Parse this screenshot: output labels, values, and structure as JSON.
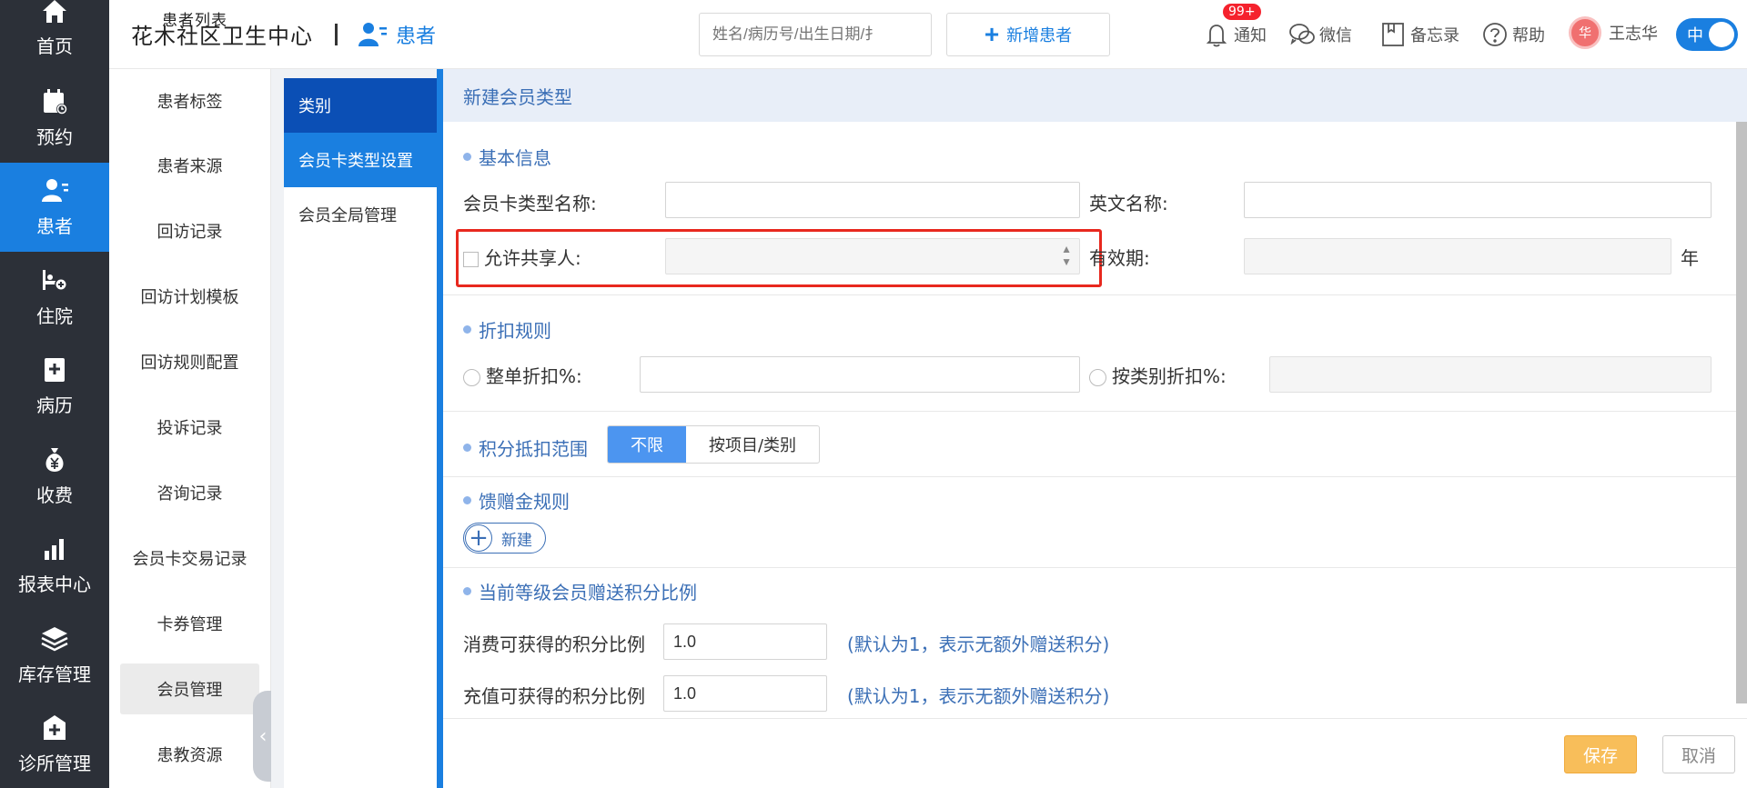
{
  "nav": {
    "items": [
      {
        "label": "首页",
        "icon": "home-icon"
      },
      {
        "label": "预约",
        "icon": "calendar-icon"
      },
      {
        "label": "患者",
        "icon": "patient-icon",
        "active": true
      },
      {
        "label": "住院",
        "icon": "bed-icon"
      },
      {
        "label": "病历",
        "icon": "medical-record-icon"
      },
      {
        "label": "收费",
        "icon": "money-bag-icon"
      },
      {
        "label": "报表中心",
        "icon": "bar-chart-icon"
      },
      {
        "label": "库存管理",
        "icon": "layers-icon"
      },
      {
        "label": "诊所管理",
        "icon": "clinic-icon"
      }
    ]
  },
  "header": {
    "clinic_name": "花木社区卫生中心",
    "ghost_text": "患者列表",
    "module": "患者",
    "search_placeholder": "姓名/病历号/出生日期/扌",
    "add_patient": "新增患者",
    "notify": "通知",
    "notify_badge": "99+",
    "wechat": "微信",
    "memo": "备忘录",
    "help": "帮助",
    "user": "王志华",
    "avatar_char": "华",
    "toggle": "中"
  },
  "subnav": {
    "items": [
      "患者标签",
      "患者来源",
      "回访记录",
      "回访计划模板",
      "回访规则配置",
      "投诉记录",
      "咨询记录",
      "会员卡交易记录",
      "卡券管理",
      "会员管理",
      "患教资源"
    ],
    "active_index": 9
  },
  "category": {
    "header": "类别",
    "items": [
      "会员卡类型设置",
      "会员全局管理"
    ]
  },
  "form": {
    "title": "新建会员类型",
    "basic": {
      "section": "基本信息",
      "name_label": "会员卡类型名称:",
      "name_value": "",
      "en_label": "英文名称:",
      "en_value": "",
      "share_label": "允许共享人:",
      "share_value": "",
      "validity_label": "有效期:",
      "validity_value": "",
      "validity_unit": "年"
    },
    "discount": {
      "section": "折扣规则",
      "whole_label": "整单折扣%:",
      "whole_value": "",
      "category_label": "按类别折扣%:",
      "category_value": ""
    },
    "points": {
      "section": "积分抵扣范围",
      "options": [
        "不限",
        "按项目/类别"
      ],
      "selected": "不限"
    },
    "gift": {
      "section": "馈赠金规则",
      "new_label": "新建"
    },
    "ratio": {
      "section": "当前等级会员赠送积分比例",
      "consume_label": "消费可获得的积分比例",
      "consume_value": "1.0",
      "recharge_label": "充值可获得的积分比例",
      "recharge_value": "1.0",
      "note": "(默认为1，表示无额外赠送积分)"
    },
    "save": "保存",
    "cancel": "取消"
  },
  "colors": {
    "accent": "#1a7fe0",
    "nav_bg": "#2c3038",
    "highlight": "#e8281e",
    "save": "#f8be5a"
  }
}
